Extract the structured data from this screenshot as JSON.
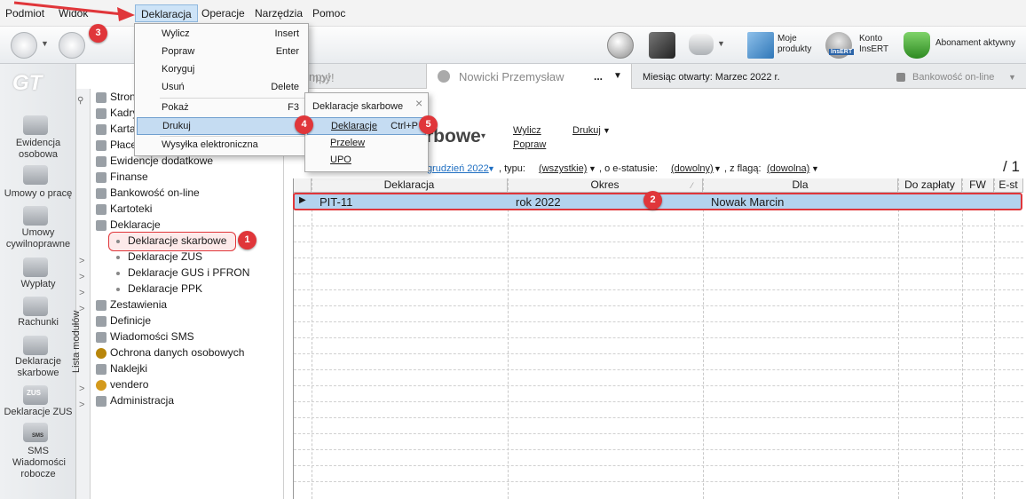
{
  "menubar": {
    "items": [
      "Podmiot",
      "Widok",
      "Deklaracja",
      "Operacje",
      "Narzędzia",
      "Pomoc"
    ]
  },
  "toolbar": {
    "moje_produkty": "Moje produkty",
    "konto_insert": "Konto InsERT",
    "abonament": "Abonament aktywny",
    "insert_logo": "InsERT"
  },
  "leftnav": {
    "logo": "GT",
    "items": [
      "Ewidencja osobowa",
      "Umowy o pracę",
      "Umowy cywilnoprawne",
      "Wypłaty",
      "Rachunki",
      "Deklaracje skarbowe",
      "Deklaracje ZUS",
      "SMS Wiadomości robocze"
    ],
    "sms_icon_text": "SMS",
    "zus_icon_text": "ZUS"
  },
  "tabs": {
    "search_fragment": "npy!",
    "user": "Nowicki Przemysław",
    "user_dots": "...",
    "month_label": "Miesiąc otwarty: Marzec 2022 r.",
    "bank": "Bankowość on-line"
  },
  "modules_label": "Lista modułów",
  "tree": {
    "items": [
      "Stron",
      "Kadry",
      "Karta",
      "Płace",
      "Ewidencje dodatkowe",
      "Finanse",
      "Bankowość on-line",
      "Kartoteki",
      "Deklaracje"
    ],
    "sub": [
      "Deklaracje skarbowe",
      "Deklaracje ZUS",
      "Deklaracje GUS i PFRON",
      "Deklaracje PPK"
    ],
    "rest": [
      "Zestawienia",
      "Definicje",
      "Wiadomości SMS",
      "Ochrona danych osobowych",
      "Naklejki",
      "vendero",
      "Administracja"
    ]
  },
  "content": {
    "title_fragment": "rbowe",
    "wylicz": "Wylicz",
    "popraw": "Popraw",
    "drukuj": "Drukuj",
    "filter_month": "grudzień 2022",
    "filter_typ_label": ", typu:",
    "filter_typ": "(wszystkie)",
    "filter_estatus_label": ", o e-statusie:",
    "filter_estatus": "(dowolny)",
    "filter_flag_label": ", z flagą:",
    "filter_flag": "(dowolna)",
    "page_count": "/ 1"
  },
  "grid": {
    "headers": [
      "Deklaracja",
      "Okres",
      "Dla",
      "Do zapłaty",
      "FW",
      "E-st"
    ],
    "row": {
      "deklaracja": "PIT-11",
      "okres": "rok 2022",
      "dla": "Nowak Marcin"
    }
  },
  "menu_deklaracja": {
    "items": [
      {
        "label": "Wylicz",
        "shortcut": "Insert"
      },
      {
        "label": "Popraw",
        "shortcut": "Enter"
      },
      {
        "label": "Koryguj",
        "shortcut": ""
      },
      {
        "label": "Usuń",
        "shortcut": "Delete"
      },
      {
        "label": "Pokaż",
        "shortcut": "F3"
      },
      {
        "label": "Drukuj",
        "shortcut": ""
      },
      {
        "label": "Wysyłka elektroniczna",
        "shortcut": ""
      }
    ]
  },
  "submenu": {
    "title": "Deklaracje skarbowe",
    "close": "×",
    "items": [
      {
        "label": "Deklaracje",
        "shortcut": "Ctrl+P"
      },
      {
        "label": "Przelew",
        "shortcut": ""
      },
      {
        "label": "UPO",
        "shortcut": ""
      }
    ]
  },
  "badges": [
    "1",
    "2",
    "3",
    "4",
    "5"
  ]
}
